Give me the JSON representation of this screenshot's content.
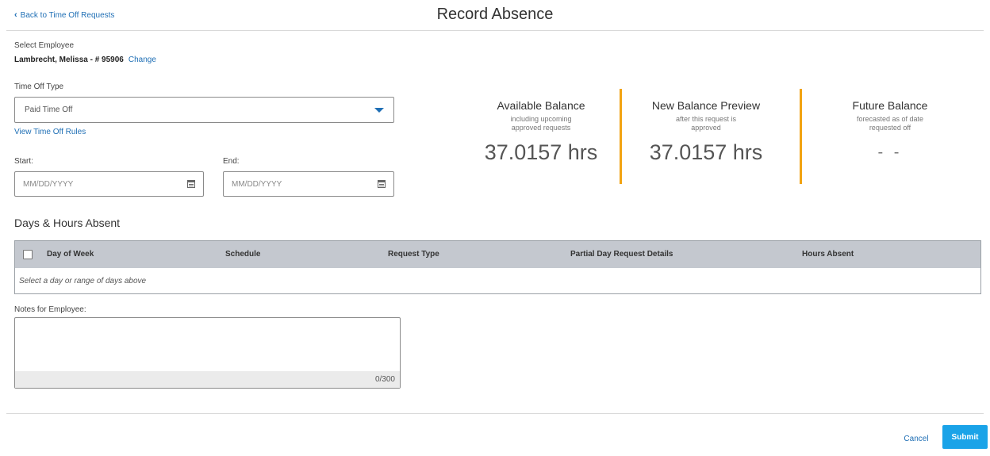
{
  "header": {
    "back_label": "Back to Time Off Requests",
    "title": "Record Absence"
  },
  "employee": {
    "label": "Select Employee",
    "name": "Lambrecht, Melissa - # 95906",
    "change_label": "Change"
  },
  "time_off": {
    "label": "Time Off Type",
    "selected": "Paid Time Off",
    "rules_link": "View Time Off Rules"
  },
  "dates": {
    "start_label": "Start:",
    "start_placeholder": "MM/DD/YYYY",
    "end_label": "End:",
    "end_placeholder": "MM/DD/YYYY"
  },
  "balances": [
    {
      "title": "Available Balance",
      "subtitle_1": "including upcoming",
      "subtitle_2": "approved requests",
      "value": "37.0157 hrs"
    },
    {
      "title": "New Balance Preview",
      "subtitle_1": "after this request is",
      "subtitle_2": "approved",
      "value": "37.0157 hrs"
    },
    {
      "title": "Future Balance",
      "subtitle_1": "forecasted as of date",
      "subtitle_2": "requested off",
      "value": "- -"
    }
  ],
  "accent_color": "#f2a312",
  "days_section": {
    "title": "Days & Hours Absent",
    "columns": [
      "Day of Week",
      "Schedule",
      "Request Type",
      "Partial Day Request Details",
      "Hours Absent"
    ],
    "empty_message": "Select a day or range of days above"
  },
  "notes": {
    "label": "Notes for Employee:",
    "value": "",
    "counter": "0/300"
  },
  "footer": {
    "cancel_label": "Cancel",
    "submit_label": "Submit"
  }
}
